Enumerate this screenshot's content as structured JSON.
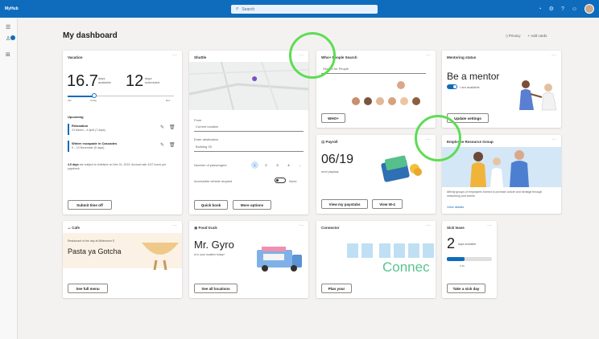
{
  "header": {
    "app_name": "MyHub",
    "search_placeholder": "Search",
    "search_icon": "search-icon",
    "icons": [
      "alert-icon",
      "settings-icon",
      "help-icon",
      "feedback-icon"
    ]
  },
  "page": {
    "title": "My dashboard",
    "privacy_label": "Privacy",
    "add_cards_label": "Add cards"
  },
  "vacation": {
    "title": "Vacation",
    "days_available": "16.7",
    "days_available_label": "days available",
    "days_scheduled": "12",
    "days_scheduled_label": "days scheduled",
    "slider_value_fraction": 0.25,
    "slider_labels": [
      "Jan",
      "Today",
      "Dec"
    ],
    "upcoming_label": "Upcoming",
    "upcoming": [
      {
        "name": "Relaxation",
        "dates": "24 March – 4 April (7 days)"
      },
      {
        "name": "Winter escapade in Cascades",
        "dates": "5 – 10 November (5 days)"
      }
    ],
    "forfeit_text_bold": "4.5 days",
    "forfeit_text": "are subject to forfeiture on Dec 31, 2019. Accrual rate: 6.67 hours per paycheck",
    "submit_button": "Submit time off"
  },
  "shuttle": {
    "title": "Shuttle",
    "from_label": "From",
    "from_value": "Current location",
    "destination_label": "Enter destination",
    "destination_value": "Building 25",
    "passengers_label": "Number of passengers",
    "passengers_options": [
      "1",
      "2",
      "3",
      "4",
      "..."
    ],
    "accessible_label": "Accessible vehicle request",
    "accessible_value": "None",
    "quick_book": "Quick book",
    "more_options": "More options"
  },
  "people_search": {
    "title": "Who+ People Search",
    "input_placeholder": "Search for People",
    "button": "WHO+"
  },
  "mentoring": {
    "title": "Mentoring status",
    "heading": "Be a mentor",
    "toggle_label": "I am available",
    "update_button": "Update settings"
  },
  "payroll": {
    "title": "Payroll",
    "date": "06/19",
    "subtitle": "next payday",
    "view_paystubs": "View my paystubs",
    "view_w4": "View W-4"
  },
  "erg": {
    "title": "Employee Resource Group",
    "description": "Affinity groups of employees formed to promote culture and heritage through networking and events",
    "link": "View details"
  },
  "cafe": {
    "title": "Cafe",
    "subtitle": "Restaurant of the day at Millennium E",
    "dish": "Pasta ya Gotcha",
    "button": "See full menu"
  },
  "food_truck": {
    "title": "Food truck",
    "name": "Mr. Gyro",
    "subtitle": "is in your location today!",
    "button": "See all locations"
  },
  "connector": {
    "title": "Connector",
    "graphic_text": "Connec",
    "button": "Plan your"
  },
  "sick_leave": {
    "title": "Sick leave",
    "days": "2",
    "days_label": "days available",
    "progress_fraction": 0.4,
    "progress_note": "2.46",
    "button": "Take a sick day"
  },
  "colors": {
    "brand": "#0f6cbd",
    "highlight": "#5fdc52",
    "page_bg": "#f3f2f1"
  }
}
